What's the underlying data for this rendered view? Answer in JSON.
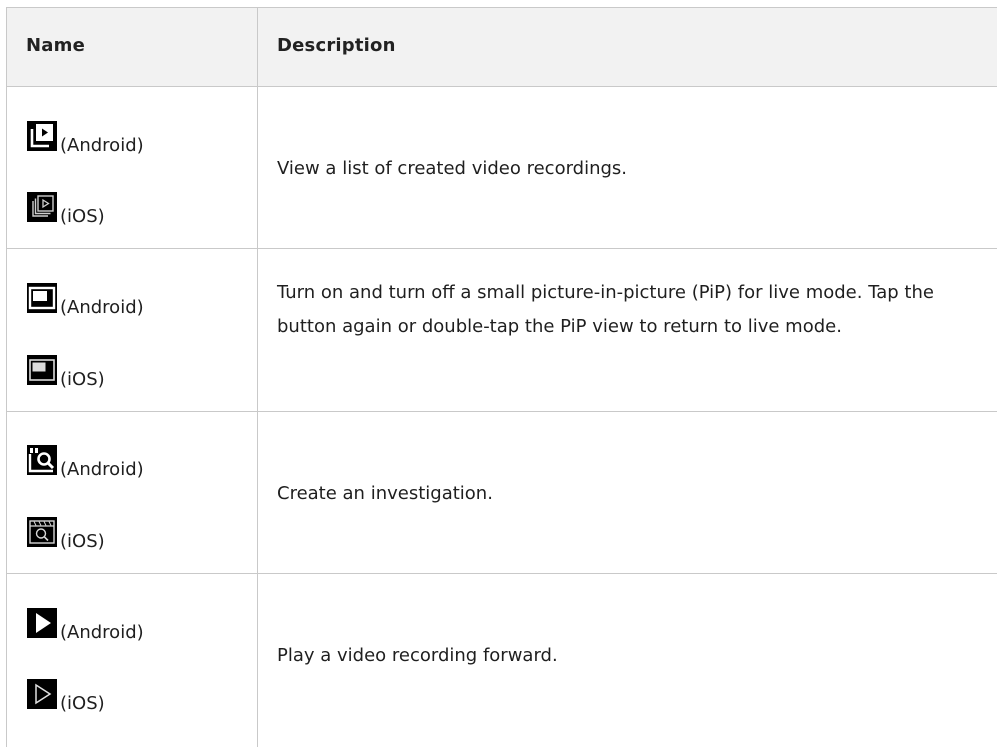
{
  "table": {
    "headers": {
      "name": "Name",
      "description": "Description"
    },
    "rows": [
      {
        "android_icon": "recordings-list-icon",
        "android_label": "(Android)",
        "ios_icon": "recordings-list-outline-icon",
        "ios_label": "(iOS)",
        "description": "View a list of created video recordings."
      },
      {
        "android_icon": "picture-in-picture-icon",
        "android_label": "(Android)",
        "ios_icon": "picture-in-picture-outline-icon",
        "ios_label": "(iOS)",
        "description": "Turn on and turn off a small picture-in-picture (PiP) for live mode. Tap the button again or double-tap the PiP view to return to live mode."
      },
      {
        "android_icon": "investigation-icon",
        "android_label": "(Android)",
        "ios_icon": "investigation-outline-icon",
        "ios_label": "(iOS)",
        "description": "Create an investigation."
      },
      {
        "android_icon": "play-forward-icon",
        "android_label": "(Android)",
        "ios_icon": "play-forward-outline-icon",
        "ios_label": "(iOS)",
        "description": "Play a video recording forward."
      }
    ]
  }
}
